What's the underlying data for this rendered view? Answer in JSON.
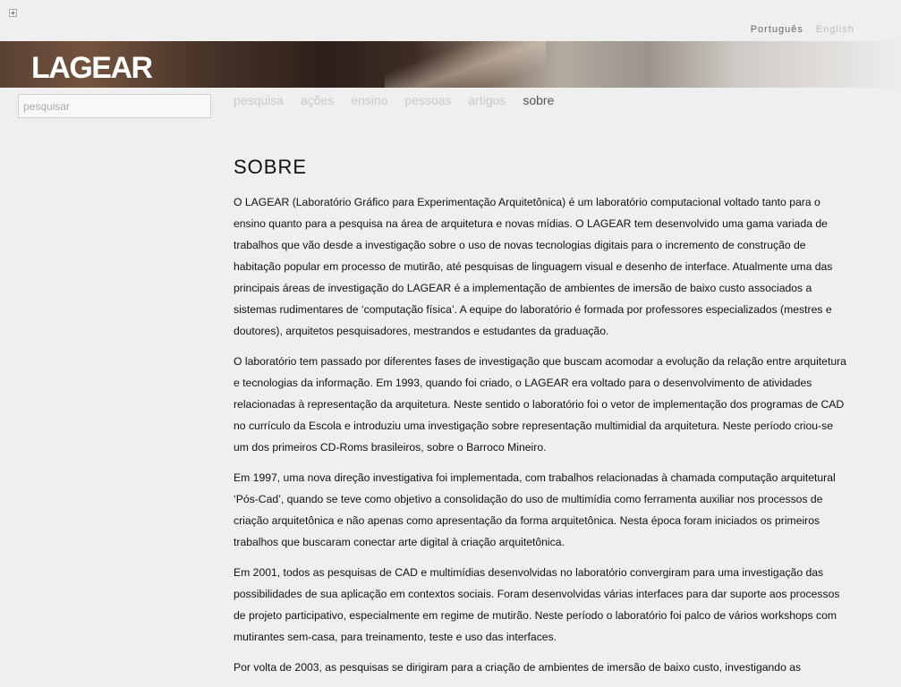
{
  "header": {
    "languages": [
      {
        "label": "Português",
        "active": true
      },
      {
        "label": "English",
        "active": false
      }
    ],
    "logo": "LAGEAR"
  },
  "search": {
    "placeholder": "pesquisar",
    "value": ""
  },
  "nav": {
    "items": [
      {
        "label": "pesquisa",
        "active": false
      },
      {
        "label": "ações",
        "active": false
      },
      {
        "label": "ensino",
        "active": false
      },
      {
        "label": "pessoas",
        "active": false
      },
      {
        "label": "artigos",
        "active": false
      },
      {
        "label": "sobre",
        "active": true
      }
    ]
  },
  "page": {
    "title": "SOBRE",
    "paragraphs": [
      "O LAGEAR (Laboratório Gráfico para Experimentação Arquitetônica) é um laboratório computacional voltado tanto para o ensino quanto para a pesquisa na área de arquitetura e novas mídias. O LAGEAR tem desenvolvido uma gama variada de trabalhos que vão desde a investigação sobre o uso de novas tecnologias digitais para o incremento de construção de habitação popular em processo de mutirão, até pesquisas de linguagem visual e desenho de interface.   Atualmente uma das principais áreas de investigação do LAGEAR é a implementação de ambientes de imersão   de baixo custo associados a sistemas rudimentares de ‘computação física’. A equipe do laboratório é formada por professores especializados (mestres e doutores), arquitetos pesquisadores, mestrandos e estudantes da graduação.",
      "O laboratório tem passado por diferentes fases de investigação que buscam acomodar a evolução da relação entre arquitetura e tecnologias da informação. Em 1993, quando foi criado, o LAGEAR era voltado para o desenvolvimento de atividades relacionadas à representação da arquitetura. Neste sentido o laboratório foi o vetor de implementação dos programas de CAD no currículo da Escola e introduziu uma investigação sobre representação multimidial da arquitetura. Neste período criou-se um dos primeiros CD-Roms brasileiros, sobre o Barroco Mineiro.",
      "Em 1997, uma nova direção investigativa foi implementada, com trabalhos relacionadas à chamada computação arquitetural ‘Pós-Cad’, quando se teve como objetivo a consolidação do uso de multimídia como ferramenta auxiliar nos processos de criação arquitetônica e não apenas como apresentação da forma arquitetônica. Nesta época foram iniciados os primeiros trabalhos que buscaram conectar arte digital à criação arquitetônica.",
      "Em 2001, todos as pesquisas de CAD e multimídias desenvolvidas no laboratório convergiram para uma investigação das possibilidades de sua aplicação em contextos sociais. Foram desenvolvidas várias interfaces para dar suporte aos processos de projeto participativo, especialmente em regime de mutirão. Neste período o laboratório foi palco de vários workshops com mutirantes sem-casa, para treinamento, teste e uso das interfaces.",
      "Por volta de 2003, as pesquisas se dirigiram para a criação de ambientes de imersão de baixo custo, investigando as"
    ]
  }
}
